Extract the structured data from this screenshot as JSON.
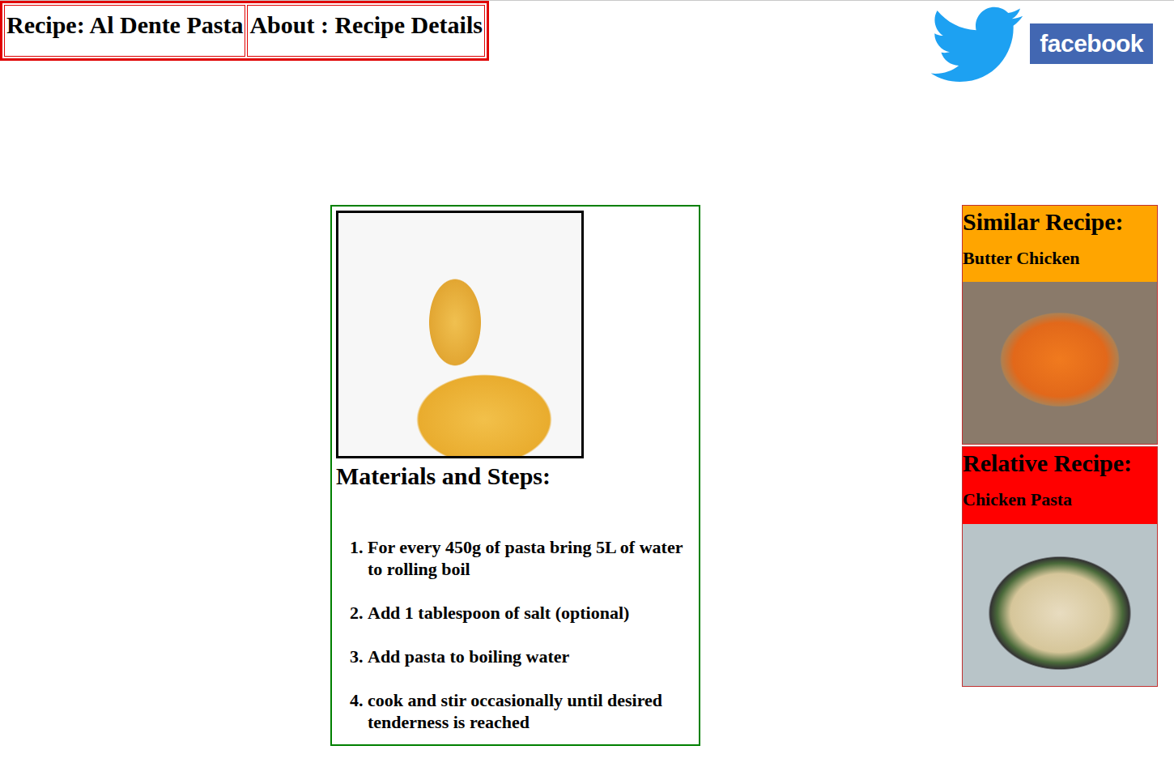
{
  "header": {
    "cells": [
      "Recipe: Al Dente Pasta",
      "About : Recipe Details"
    ]
  },
  "social": {
    "facebook": "facebook"
  },
  "recipe": {
    "heading": "Materials and Steps:",
    "steps": [
      "For every 450g of pasta bring 5L of water to rolling boil",
      "Add 1 tablespoon of salt (optional)",
      "Add pasta to boiling water",
      "cook and stir occasionally until desired tenderness is reached"
    ]
  },
  "sidebar": {
    "cards": [
      {
        "heading": "Similar Recipe:",
        "name": "Butter Chicken",
        "color": "#ffa500"
      },
      {
        "heading": "Relative Recipe:",
        "name": "Chicken Pasta",
        "color": "#ff0000"
      }
    ]
  }
}
